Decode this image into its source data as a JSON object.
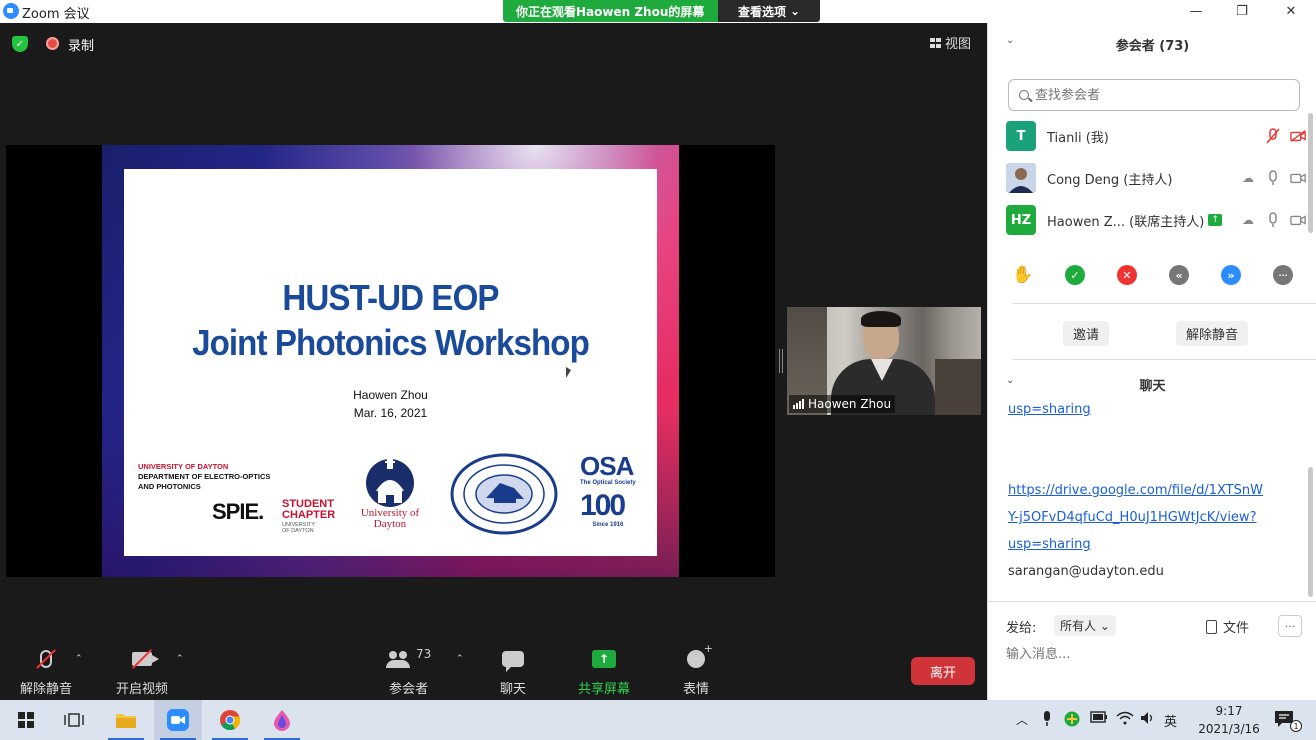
{
  "window": {
    "title": "Zoom 会议",
    "minimize": "—",
    "restore": "❐",
    "close": "✕"
  },
  "share_banner": {
    "text": "你正在观看Haowen Zhou的屏幕",
    "options": "查看选项",
    "options_caret": "⌄"
  },
  "stage": {
    "recording_label": "录制",
    "view_label": "视图",
    "shield_check": "✓"
  },
  "slide": {
    "title_line1": "HUST-UD EOP",
    "title_line2": "Joint Photonics Workshop",
    "author": "Haowen Zhou",
    "date": "Mar. 16, 2021",
    "ud_dept": [
      "UNIVERSITY OF DAYTON",
      "DEPARTMENT OF ELECTRO-OPTICS",
      "AND PHOTONICS"
    ],
    "spie": "SPIE.",
    "spie_student": [
      "STUDENT",
      "CHAPTER"
    ],
    "spie_sub": [
      "UNIVERSITY",
      "OF DAYTON"
    ],
    "ud_logo_text": [
      "University of",
      "Dayton"
    ],
    "osa": "OSA",
    "osa_sub": "The Optical Society",
    "osa_hundred": "100",
    "osa_since": "Since 1916"
  },
  "video": {
    "name": "Haowen Zhou"
  },
  "toolbar": {
    "unmute": "解除静音",
    "start_video": "开启视频",
    "participants": "参会者",
    "participants_count": "73",
    "chat": "聊天",
    "share_screen": "共享屏幕",
    "reactions": "表情",
    "leave": "离开",
    "caret": "⌃",
    "share_arrow": "↑"
  },
  "participants_panel": {
    "title": "参会者 (73)",
    "search_placeholder": "查找参会者",
    "caret": "⌄",
    "list": [
      {
        "initials": "T",
        "name": "Tianli (我)",
        "color": "#1aa37a"
      },
      {
        "initials": "",
        "name": "Cong Deng (主持人)",
        "color": "#3a4a6a"
      },
      {
        "initials": "HZ",
        "name": "Haowen Z... (联席主持人)",
        "color": "#1faa3d"
      }
    ],
    "icons": {
      "mic_muted": "🎤",
      "cam_off": "▭",
      "cloud": "☁",
      "mic": "🎙",
      "cam": "▭",
      "share": "↑"
    },
    "invite": "邀请",
    "unmute_me": "解除静音",
    "reactions": [
      "✋",
      "✓",
      "✕",
      "«",
      "»",
      "···"
    ]
  },
  "chat_panel": {
    "title": "聊天",
    "caret": "⌄",
    "messages": [
      {
        "type": "link",
        "text": "usp=sharing"
      },
      {
        "type": "blank",
        "text": ""
      },
      {
        "type": "blank",
        "text": ""
      },
      {
        "type": "link",
        "text": "https://drive.google.com/file/d/1XTSnW"
      },
      {
        "type": "link",
        "text": "Y-j5OFvD4qfuCd_H0uJ1HGWtJcK/view?"
      },
      {
        "type": "link",
        "text": "usp=sharing"
      },
      {
        "type": "text",
        "text": "sarangan@udayton.edu"
      }
    ],
    "send_to_label": "发给:",
    "send_to_value": "所有人",
    "send_to_caret": "⌄",
    "file_label": "文件",
    "more": "···",
    "input_placeholder": "输入消息..."
  },
  "taskbar": {
    "time": "9:17",
    "date": "2021/3/16",
    "ime": "英",
    "up_arrow": "︿",
    "notification_count": "1"
  }
}
